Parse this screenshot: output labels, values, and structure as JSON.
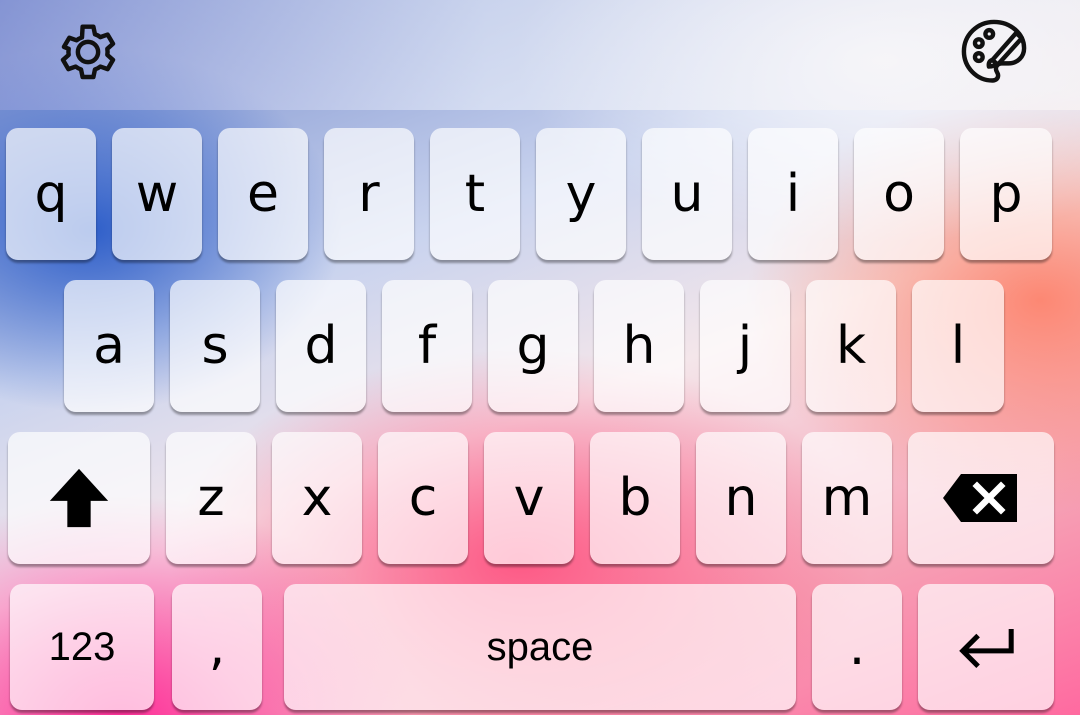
{
  "toolbar": {
    "settings_icon": "gear-icon",
    "theme_icon": "palette-brush-icon"
  },
  "keyboard": {
    "row1": [
      "q",
      "w",
      "e",
      "r",
      "t",
      "y",
      "u",
      "i",
      "o",
      "p"
    ],
    "row2": [
      "a",
      "s",
      "d",
      "f",
      "g",
      "h",
      "j",
      "k",
      "l"
    ],
    "row3": [
      "z",
      "x",
      "c",
      "v",
      "b",
      "n",
      "m"
    ],
    "shift_icon": "shift-arrow-icon",
    "backspace_icon": "backspace-icon",
    "numbers_label": "123",
    "comma_label": ",",
    "space_label": "space",
    "period_label": ".",
    "enter_icon": "enter-return-icon"
  }
}
